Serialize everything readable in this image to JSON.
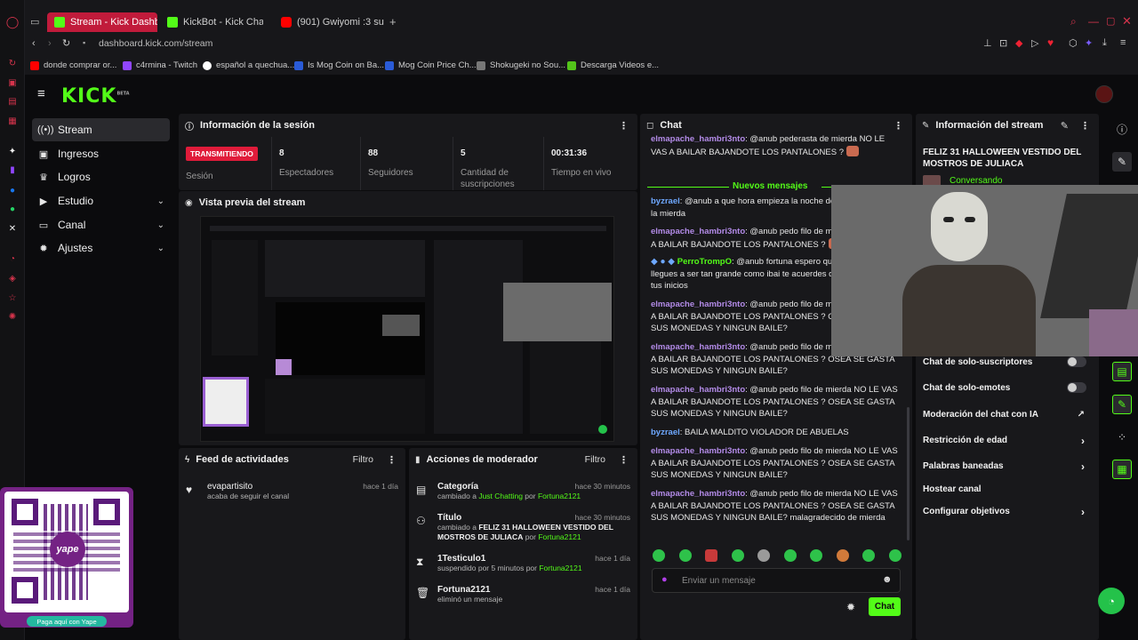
{
  "browser": {
    "tabs": [
      {
        "label": "Stream - Kick Dashboard",
        "active": true
      },
      {
        "label": "KickBot - Kick Chatbot, A",
        "active": false
      },
      {
        "label": "(901) Gwiyomi :3 sub espa",
        "active": false
      }
    ],
    "url": "dashboard.kick.com/stream",
    "bookmarks": [
      "donde comprar or...",
      "c4rmina - Twitch",
      "español a quechua...",
      "Is Mog Coin on Ba...",
      "Mog Coin Price Ch...",
      "Shokugeki no Sou...",
      "Descarga Videos e..."
    ]
  },
  "app": {
    "logo": "KICK",
    "logo_beta": "BETA",
    "sidebar": [
      {
        "label": "Stream",
        "icon": "broadcast-icon",
        "active": true,
        "expand": false
      },
      {
        "label": "Ingresos",
        "icon": "dollar-icon",
        "active": false,
        "expand": false
      },
      {
        "label": "Logros",
        "icon": "trophy-icon",
        "active": false,
        "expand": false
      },
      {
        "label": "Estudio",
        "icon": "video-icon",
        "active": false,
        "expand": true
      },
      {
        "label": "Canal",
        "icon": "tv-icon",
        "active": false,
        "expand": true
      },
      {
        "label": "Ajustes",
        "icon": "gear-icon",
        "active": false,
        "expand": true
      }
    ]
  },
  "session": {
    "title": "Información de la sesión",
    "live_badge": "TRANSMITIENDO",
    "live_label": "Sesión",
    "stats": [
      {
        "value": "8",
        "label": "Espectadores"
      },
      {
        "value": "88",
        "label": "Seguidores"
      },
      {
        "value": "5",
        "label": "Cantidad de suscripciones"
      },
      {
        "value": "00:31:36",
        "label": "Tiempo en vivo"
      }
    ]
  },
  "preview": {
    "title": "Vista previa del stream"
  },
  "activity": {
    "title": "Feed de actividades",
    "filter": "Filtro",
    "items": [
      {
        "user": "evapartisito",
        "text": "acaba de seguir el canal",
        "time": "hace 1 día"
      }
    ]
  },
  "modactions": {
    "title": "Acciones de moderador",
    "filter": "Filtro",
    "items": [
      {
        "title": "Categoría",
        "pre": "cambiado a ",
        "highlight": "Just Chatting",
        "by": " por ",
        "user": "Fortuna2121",
        "time": "hace 30 minutos",
        "icon": "category-icon"
      },
      {
        "title": "Título",
        "pre": "cambiado a ",
        "highlight": "FELIZ 31 HALLOWEEN VESTIDO DEL MOSTROS DE JULIACA",
        "by": " por ",
        "user": "Fortuna2121",
        "time": "hace 30 minutos",
        "icon": "users-icon"
      },
      {
        "title": "1Testiculo1",
        "pre": "suspendido por 5 minutos",
        "highlight": "",
        "by": " por ",
        "user": "Fortuna2121",
        "time": "hace 1 día",
        "icon": "hourglass-icon"
      },
      {
        "title": "Fortuna2121",
        "pre": "eliminó un mensaje",
        "highlight": "",
        "by": "",
        "user": "",
        "time": "hace 1 día",
        "icon": "trash-icon"
      }
    ]
  },
  "chat": {
    "title": "Chat",
    "new_messages": "Nuevos mensajes",
    "messages": [
      {
        "user": "elmapache_hambri3nto",
        "cls": "u1",
        "text": ": @anub pederasta de mierda NO LE VAS A BAILAR BAJANDOTE LOS PANTALONES ?",
        "emote": true
      },
      {
        "user": "byzrael",
        "cls": "u2",
        "text": ": @anub a que hora empieza la noche de terror? gatos de la mierda",
        "emote": false
      },
      {
        "user": "elmapache_hambri3nto",
        "cls": "u1",
        "text": ": @anub pedo filo de mierda NO LE VAS A BAILAR BAJANDOTE LOS PANTALONES ?",
        "emote": true
      },
      {
        "user": "PerroTrompO",
        "cls": "u3",
        "text": ": @anub fortuna espero que algun dia llegues a ser tan grande como ibai te acuerdes de quien estuvo en tus inicios",
        "emote": false
      },
      {
        "user": "elmapache_hambri3nto",
        "cls": "u1",
        "text": ": @anub pedo filo de mierda NO LE VAS A BAILAR BAJANDOTE LOS PANTALONES ? OSEA SE GASTA SUS MONEDAS Y NINGUN BAILE?",
        "emote": false
      },
      {
        "user": "elmapache_hambri3nto",
        "cls": "u1",
        "text": ": @anub pedo filo de mierda NO LE VAS A BAILAR BAJANDOTE LOS PANTALONES ? OSEA SE GASTA SUS MONEDAS Y NINGUN BAILE?",
        "emote": false
      },
      {
        "user": "elmapache_hambri3nto",
        "cls": "u1",
        "text": ": @anub pedo filo de mierda NO LE VAS A BAILAR BAJANDOTE LOS PANTALONES ? OSEA SE GASTA SUS MONEDAS Y NINGUN BAILE?",
        "emote": false
      },
      {
        "user": "byzrael",
        "cls": "u2",
        "text": ": BAILA MALDITO VIOLADOR DE ABUELAS",
        "emote": false
      },
      {
        "user": "elmapache_hambri3nto",
        "cls": "u1",
        "text": ": @anub pedo filo de mierda NO LE VAS A BAILAR BAJANDOTE LOS PANTALONES ? OSEA SE GASTA SUS MONEDAS Y NINGUN BAILE?",
        "emote": false
      },
      {
        "user": "elmapache_hambri3nto",
        "cls": "u1",
        "text": ": @anub pedo filo de mierda NO LE VAS A BAILAR BAJANDOTE LOS PANTALONES ? OSEA SE GASTA SUS MONEDAS Y NINGUN BAILE? malagradecido de mierda",
        "emote": false
      }
    ],
    "input_placeholder": "Enviar un mensaje",
    "send_label": "Chat"
  },
  "streaminfo": {
    "title": "Información del stream",
    "stream_title": "FELIZ 31 HALLOWEEN VESTIDO DEL MOSTROS DE JULIACA",
    "category": "Conversando",
    "settings": [
      {
        "label": "Chat de solo-suscriptores",
        "kind": "toggle"
      },
      {
        "label": "Chat de solo-emotes",
        "kind": "toggle"
      },
      {
        "label": "Moderación del chat con IA",
        "kind": "external"
      },
      {
        "label": "Restricción de edad",
        "kind": "chevron"
      },
      {
        "label": "Palabras baneadas",
        "kind": "chevron"
      },
      {
        "label": "Hostear canal",
        "kind": "none"
      },
      {
        "label": "Configurar objetivos",
        "kind": "chevron"
      }
    ]
  },
  "qr": {
    "label": "Paga aquí con Yape",
    "brand": "yape"
  },
  "colors": {
    "kick_green": "#53fc18",
    "live_red": "#e01b3a",
    "panel": "#18181b",
    "opera_red": "#c11b3b",
    "yape_purple": "#742284"
  }
}
